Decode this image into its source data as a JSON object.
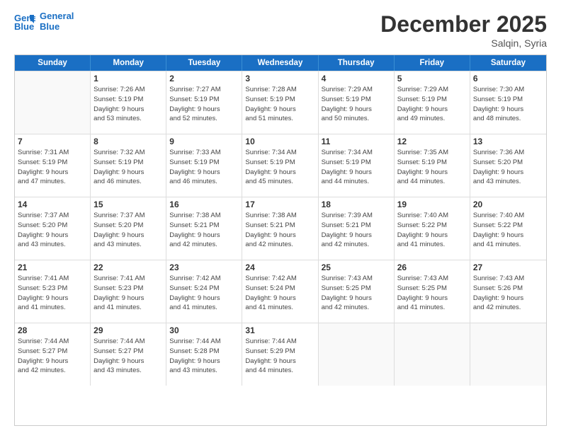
{
  "header": {
    "logo_line1": "General",
    "logo_line2": "Blue",
    "title": "December 2025",
    "subtitle": "Salqin, Syria"
  },
  "weekdays": [
    "Sunday",
    "Monday",
    "Tuesday",
    "Wednesday",
    "Thursday",
    "Friday",
    "Saturday"
  ],
  "rows": [
    [
      {
        "day": "",
        "info": ""
      },
      {
        "day": "1",
        "info": "Sunrise: 7:26 AM\nSunset: 5:19 PM\nDaylight: 9 hours\nand 53 minutes."
      },
      {
        "day": "2",
        "info": "Sunrise: 7:27 AM\nSunset: 5:19 PM\nDaylight: 9 hours\nand 52 minutes."
      },
      {
        "day": "3",
        "info": "Sunrise: 7:28 AM\nSunset: 5:19 PM\nDaylight: 9 hours\nand 51 minutes."
      },
      {
        "day": "4",
        "info": "Sunrise: 7:29 AM\nSunset: 5:19 PM\nDaylight: 9 hours\nand 50 minutes."
      },
      {
        "day": "5",
        "info": "Sunrise: 7:29 AM\nSunset: 5:19 PM\nDaylight: 9 hours\nand 49 minutes."
      },
      {
        "day": "6",
        "info": "Sunrise: 7:30 AM\nSunset: 5:19 PM\nDaylight: 9 hours\nand 48 minutes."
      }
    ],
    [
      {
        "day": "7",
        "info": "Sunrise: 7:31 AM\nSunset: 5:19 PM\nDaylight: 9 hours\nand 47 minutes."
      },
      {
        "day": "8",
        "info": "Sunrise: 7:32 AM\nSunset: 5:19 PM\nDaylight: 9 hours\nand 46 minutes."
      },
      {
        "day": "9",
        "info": "Sunrise: 7:33 AM\nSunset: 5:19 PM\nDaylight: 9 hours\nand 46 minutes."
      },
      {
        "day": "10",
        "info": "Sunrise: 7:34 AM\nSunset: 5:19 PM\nDaylight: 9 hours\nand 45 minutes."
      },
      {
        "day": "11",
        "info": "Sunrise: 7:34 AM\nSunset: 5:19 PM\nDaylight: 9 hours\nand 44 minutes."
      },
      {
        "day": "12",
        "info": "Sunrise: 7:35 AM\nSunset: 5:19 PM\nDaylight: 9 hours\nand 44 minutes."
      },
      {
        "day": "13",
        "info": "Sunrise: 7:36 AM\nSunset: 5:20 PM\nDaylight: 9 hours\nand 43 minutes."
      }
    ],
    [
      {
        "day": "14",
        "info": "Sunrise: 7:37 AM\nSunset: 5:20 PM\nDaylight: 9 hours\nand 43 minutes."
      },
      {
        "day": "15",
        "info": "Sunrise: 7:37 AM\nSunset: 5:20 PM\nDaylight: 9 hours\nand 43 minutes."
      },
      {
        "day": "16",
        "info": "Sunrise: 7:38 AM\nSunset: 5:21 PM\nDaylight: 9 hours\nand 42 minutes."
      },
      {
        "day": "17",
        "info": "Sunrise: 7:38 AM\nSunset: 5:21 PM\nDaylight: 9 hours\nand 42 minutes."
      },
      {
        "day": "18",
        "info": "Sunrise: 7:39 AM\nSunset: 5:21 PM\nDaylight: 9 hours\nand 42 minutes."
      },
      {
        "day": "19",
        "info": "Sunrise: 7:40 AM\nSunset: 5:22 PM\nDaylight: 9 hours\nand 41 minutes."
      },
      {
        "day": "20",
        "info": "Sunrise: 7:40 AM\nSunset: 5:22 PM\nDaylight: 9 hours\nand 41 minutes."
      }
    ],
    [
      {
        "day": "21",
        "info": "Sunrise: 7:41 AM\nSunset: 5:23 PM\nDaylight: 9 hours\nand 41 minutes."
      },
      {
        "day": "22",
        "info": "Sunrise: 7:41 AM\nSunset: 5:23 PM\nDaylight: 9 hours\nand 41 minutes."
      },
      {
        "day": "23",
        "info": "Sunrise: 7:42 AM\nSunset: 5:24 PM\nDaylight: 9 hours\nand 41 minutes."
      },
      {
        "day": "24",
        "info": "Sunrise: 7:42 AM\nSunset: 5:24 PM\nDaylight: 9 hours\nand 41 minutes."
      },
      {
        "day": "25",
        "info": "Sunrise: 7:43 AM\nSunset: 5:25 PM\nDaylight: 9 hours\nand 42 minutes."
      },
      {
        "day": "26",
        "info": "Sunrise: 7:43 AM\nSunset: 5:25 PM\nDaylight: 9 hours\nand 41 minutes."
      },
      {
        "day": "27",
        "info": "Sunrise: 7:43 AM\nSunset: 5:26 PM\nDaylight: 9 hours\nand 42 minutes."
      }
    ],
    [
      {
        "day": "28",
        "info": "Sunrise: 7:44 AM\nSunset: 5:27 PM\nDaylight: 9 hours\nand 42 minutes."
      },
      {
        "day": "29",
        "info": "Sunrise: 7:44 AM\nSunset: 5:27 PM\nDaylight: 9 hours\nand 43 minutes."
      },
      {
        "day": "30",
        "info": "Sunrise: 7:44 AM\nSunset: 5:28 PM\nDaylight: 9 hours\nand 43 minutes."
      },
      {
        "day": "31",
        "info": "Sunrise: 7:44 AM\nSunset: 5:29 PM\nDaylight: 9 hours\nand 44 minutes."
      },
      {
        "day": "",
        "info": ""
      },
      {
        "day": "",
        "info": ""
      },
      {
        "day": "",
        "info": ""
      }
    ]
  ]
}
